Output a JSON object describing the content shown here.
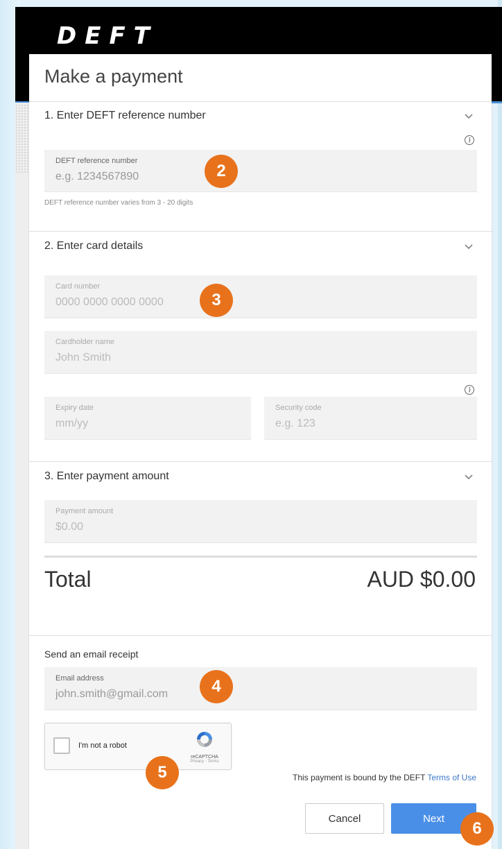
{
  "brand": {
    "logo": "DEFT"
  },
  "page": {
    "title": "Make a payment"
  },
  "section1": {
    "heading": "1. Enter DEFT reference number",
    "ref_label": "DEFT reference number",
    "ref_placeholder": "e.g. 1234567890",
    "hint": "DEFT reference number varies from 3 - 20 digits"
  },
  "section2": {
    "heading": "2. Enter card details",
    "card_label": "Card number",
    "card_placeholder": "0000 0000 0000 0000",
    "name_label": "Cardholder name",
    "name_placeholder": "John Smith",
    "expiry_label": "Expiry date",
    "expiry_placeholder": "mm/yy",
    "cvv_label": "Security code",
    "cvv_placeholder": "e.g. 123"
  },
  "section3": {
    "heading": "3. Enter payment amount",
    "amount_label": "Payment amount",
    "amount_placeholder": "$0.00"
  },
  "total": {
    "label": "Total",
    "value": "AUD $0.00"
  },
  "receipt": {
    "label": "Send an email receipt",
    "email_label": "Email address",
    "email_placeholder": "john.smith@gmail.com"
  },
  "recaptcha": {
    "text": "I'm not a robot",
    "brand": "reCAPTCHA",
    "links": "Privacy - Terms"
  },
  "terms": {
    "prefix": "This payment is bound by the DEFT ",
    "link": "Terms of Use"
  },
  "actions": {
    "cancel": "Cancel",
    "next": "Next"
  },
  "callouts": [
    "2",
    "3",
    "4",
    "5",
    "6"
  ],
  "colors": {
    "accent": "#4a8fe7",
    "callout": "#e8721c",
    "header": "#000000"
  }
}
